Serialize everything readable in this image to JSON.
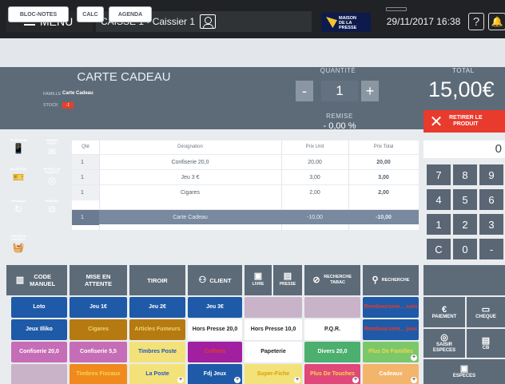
{
  "topbar": {
    "menu_label": "MENU",
    "caisse_label": "CAISSE 1 - Caissier 1",
    "logo_text_1": "MAISON",
    "logo_text_2": "DE LA PRESSE",
    "datetime": "29/11/2017 16:38",
    "help_icon": "?"
  },
  "toolbar": {
    "bloc_notes": "BLOC-NOTES",
    "calc": "CALC",
    "agenda": "AGENDA"
  },
  "product": {
    "title": "CARTE CADEAU",
    "famille_label": "FAMILLE",
    "famille_value": "Carte Cadeau",
    "stock_label": "STOCK",
    "stock_value": "-1"
  },
  "quantity": {
    "label": "QUANTITÉ",
    "value": "1",
    "minus": "-",
    "plus": "+"
  },
  "remise": {
    "label": "REMISE",
    "value": "- 0,00 %"
  },
  "total": {
    "label": "TOTAL",
    "value": "15,00€"
  },
  "retirer": {
    "line1": "RETIRER LE",
    "line2": "PRODUIT"
  },
  "categories": [
    {
      "label": "TÉLÉPHONIE",
      "color": "#e63a2d",
      "icon": "phone-icon",
      "glyph": "📱"
    },
    {
      "label": "TIMBRES POSTE",
      "color": "#3aa0e0",
      "icon": "stamp-icon",
      "glyph": "✉"
    },
    {
      "label": "BILLETERIE",
      "color": "#e63a2d",
      "icon": "ticket-icon",
      "glyph": "🎫"
    },
    {
      "label": "RETRAIT DE PAQUETS",
      "color": "#e63a2d",
      "icon": "package-icon",
      "glyph": "◎"
    },
    {
      "label": "Recharges",
      "color": "#e63a2d",
      "icon": "recharge-icon",
      "glyph": "↻"
    },
    {
      "label": "SERVICES",
      "color": "#3aa0e0",
      "icon": "services-icon",
      "glyph": "⧉"
    },
    {
      "label": "CENTRALE D'ACHATS",
      "color": "#e63a2d",
      "icon": "basket-icon",
      "glyph": "🧺"
    }
  ],
  "table": {
    "headers": [
      "Qté",
      "Désignation",
      "Prix Unit",
      "Prix Total"
    ],
    "rows": [
      {
        "qty": "1",
        "designation": "Confiserie 20,0",
        "unit": "20,00",
        "total": "20,00"
      },
      {
        "qty": "1",
        "designation": "Jeu 3 €",
        "unit": "3,00",
        "total": "3,00"
      },
      {
        "qty": "1",
        "designation": "Cigares",
        "unit": "2,00",
        "total": "2,00"
      },
      {
        "qty": "1",
        "designation": "Carte Cadeau",
        "unit": "-10,00",
        "total": "-10,00"
      }
    ]
  },
  "keypad": {
    "display": "0",
    "keys": [
      "7",
      "8",
      "9",
      "4",
      "5",
      "6",
      "1",
      "2",
      "3",
      "C",
      "0",
      "-"
    ]
  },
  "functions": {
    "code_manuel": "CODE MANUEL",
    "mise_en_attente": "MISE EN ATTENTE",
    "tiroir": "TIROIR",
    "client": "CLIENT",
    "livre": "LIVRE",
    "presse": "PRESSE",
    "recherche_tabac": "RECHERCHE TABAC",
    "recherche": "RECHERCHE"
  },
  "products": [
    {
      "label": "Loto",
      "color": "#1e5aa8"
    },
    {
      "label": "Jeu 1€",
      "color": "#1e5aa8"
    },
    {
      "label": "Jeu 2€",
      "color": "#1e5aa8"
    },
    {
      "label": "Jeu 3€",
      "color": "#1e5aa8"
    },
    {
      "label": "",
      "color": "#c9b3c9"
    },
    {
      "label": "",
      "color": "#c9b3c9"
    },
    {
      "label": "Remboursem... soin",
      "color": "#1e5aa8",
      "text_color": "#e63a2d"
    },
    {
      "label": "Jeux Illiko",
      "color": "#1e5aa8"
    },
    {
      "label": "Cigares",
      "color": "#b57a12",
      "text_color": "#f3d36b"
    },
    {
      "label": "Articles Fumeurs",
      "color": "#b57a12",
      "text_color": "#f3d36b"
    },
    {
      "label": "Hors Presse 20,0",
      "color": "#ffffff",
      "text_color": "#222"
    },
    {
      "label": "Hors Presse 10,0",
      "color": "#ffffff",
      "text_color": "#222"
    },
    {
      "label": "P.Q.R.",
      "color": "#ffffff",
      "text_color": "#222"
    },
    {
      "label": "Remboursem... jeux",
      "color": "#1e5aa8",
      "text_color": "#e63a2d"
    },
    {
      "label": "Confiserie 20,0",
      "color": "#c66db7"
    },
    {
      "label": "Confiserie 5,5",
      "color": "#c66db7"
    },
    {
      "label": "Timbres Poste",
      "color": "#f3e27a",
      "text_color": "#2a55b5"
    },
    {
      "label": "Coffrets",
      "color": "#a020a0",
      "text_color": "#e63a2d"
    },
    {
      "label": "Papeterie",
      "color": "#ffffff",
      "text_color": "#222"
    },
    {
      "label": "Divers 20,0",
      "color": "#4caf6e"
    },
    {
      "label": "Plus De Familles",
      "color": "#7bc86a",
      "text_color": "#f4d84a"
    },
    {
      "label": "",
      "color": "#c9b3c9"
    },
    {
      "label": "Timbres Fiscaux",
      "color": "#f08a1e",
      "text_color": "#f4d84a"
    },
    {
      "label": "La Poste",
      "color": "#f3e27a",
      "text_color": "#2a55b5"
    },
    {
      "label": "Fdj Jeux",
      "color": "#1e5aa8"
    },
    {
      "label": "Super-Fiche",
      "color": "#f3e27a",
      "text_color": "#d8a000"
    },
    {
      "label": "Plus De Touches",
      "color": "#e0487a",
      "text_color": "#f4d84a"
    },
    {
      "label": "Cadeaux",
      "color": "#f3b46b",
      "text_color": "#fff"
    }
  ],
  "payment": {
    "paiement": "PAIEMENT",
    "cheque": "CHEQUE",
    "saisir_especes": "SAISIR ESPECES",
    "cb": "CB",
    "especes": "ESPECES"
  }
}
